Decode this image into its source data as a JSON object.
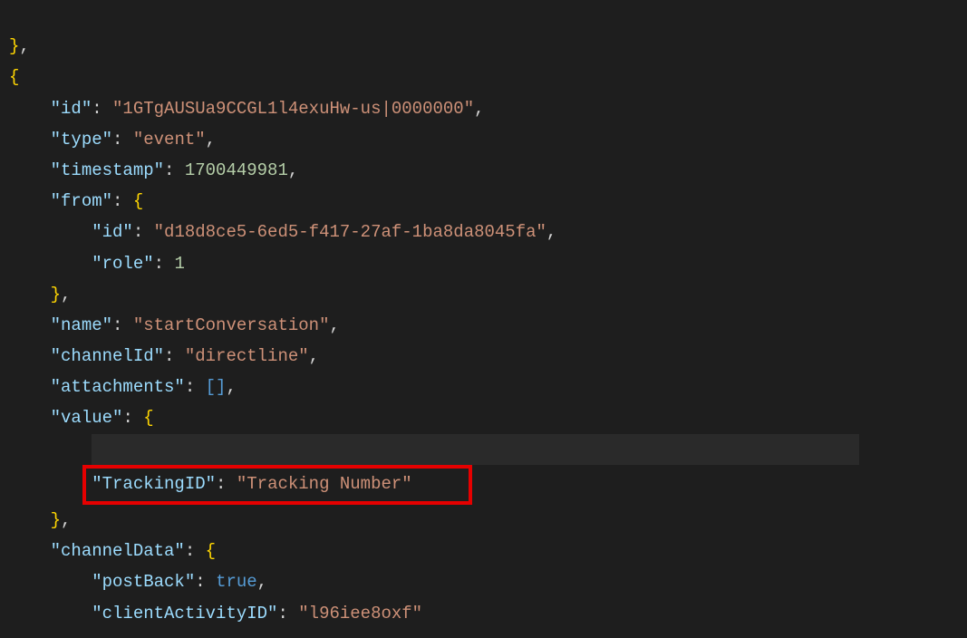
{
  "snippet": {
    "brace_top_outer": "}",
    "brace_open_obj": "{",
    "id_key": "\"id\"",
    "id_val": "\"1GTgAUSUa9CCGL1l4exuHw-us|0000000\"",
    "type_key": "\"type\"",
    "type_val": "\"event\"",
    "timestamp_key": "\"timestamp\"",
    "timestamp_val": "1700449981",
    "from_key": "\"from\"",
    "from_id_key": "\"id\"",
    "from_id_val": "\"d18d8ce5-6ed5-f417-27af-1ba8da8045fa\"",
    "from_role_key": "\"role\"",
    "from_role_val": "1",
    "name_key": "\"name\"",
    "name_val": "\"startConversation\"",
    "channelId_key": "\"channelId\"",
    "channelId_val": "\"directline\"",
    "attachments_key": "\"attachments\"",
    "value_key": "\"value\"",
    "tracking_key": "\"TrackingID\"",
    "tracking_val": "\"Tracking Number\"",
    "channelData_key": "\"channelData\"",
    "postBack_key": "\"postBack\"",
    "postBack_val": "true",
    "clientActivityID_key": "\"clientActivityID\"",
    "clientActivityID_val": "\"l96iee8oxf\""
  }
}
